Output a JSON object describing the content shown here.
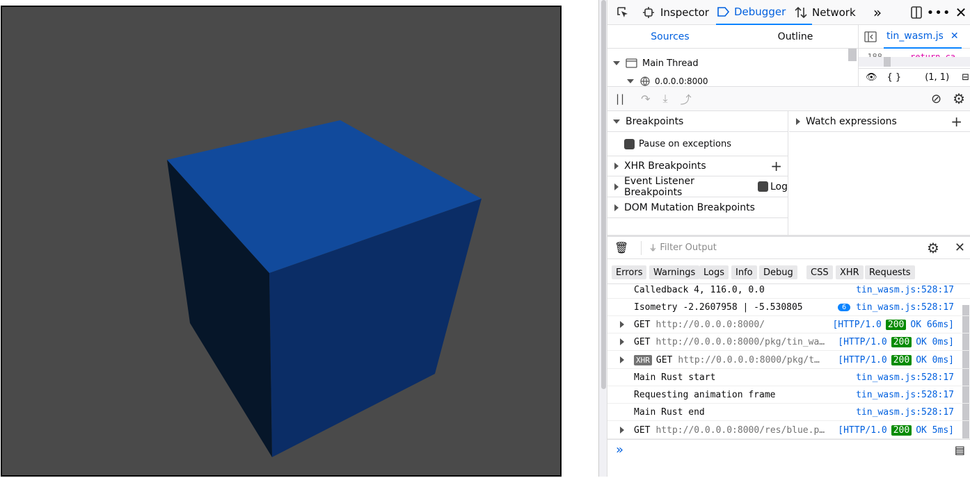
{
  "toolbar": {
    "tabs": [
      "Inspector",
      "Debugger",
      "Network"
    ]
  },
  "sources": {
    "tabs": [
      "Sources",
      "Outline"
    ],
    "main_thread": "Main Thread",
    "host": "0.0.0.0:8000"
  },
  "editor": {
    "file_tab": "tin_wasm.js",
    "line_no": "188",
    "code": "return ca",
    "cursor": "(1, 1)",
    "braces": "{ }"
  },
  "breakpoints": {
    "title": "Breakpoints",
    "pause_on_exceptions": "Pause on exceptions",
    "xhr": "XHR Breakpoints",
    "event_listener": "Event Listener Breakpoints",
    "log_label": "Log",
    "dom_mutation": "DOM Mutation Breakpoints"
  },
  "watch": {
    "title": "Watch expressions"
  },
  "console": {
    "filter_placeholder": "Filter Output",
    "filters": [
      "Errors",
      "Warnings",
      "Logs",
      "Info",
      "Debug",
      "CSS",
      "XHR",
      "Requests"
    ],
    "lines": [
      {
        "text": "Calledback 4, 116.0, 0.0",
        "source": "tin_wasm.js:528:17"
      },
      {
        "text": "Isometry -2.2607958 | -5.530805",
        "badge": "6",
        "source": "tin_wasm.js:528:17"
      },
      {
        "method": "GET",
        "url": "http://0.0.0.0:8000/",
        "http": "[HTTP/1.0",
        "status": "200",
        "result": "OK 66ms]"
      },
      {
        "method": "GET",
        "url": "http://0.0.0.0:8000/pkg/tin_wa…",
        "http": "[HTTP/1.0",
        "status": "200",
        "result": "OK 0ms]"
      },
      {
        "tag": "XHR",
        "method": "GET",
        "url": "http://0.0.0.0:8000/pkg/t…",
        "http": "[HTTP/1.0",
        "status": "200",
        "result": "OK 0ms]"
      },
      {
        "text": "Main Rust start",
        "source": "tin_wasm.js:528:17"
      },
      {
        "text": "Requesting animation frame",
        "source": "tin_wasm.js:528:17"
      },
      {
        "text": "Main Rust end",
        "source": "tin_wasm.js:528:17"
      },
      {
        "method": "GET",
        "url": "http://0.0.0.0:8000/res/blue.p…",
        "http": "[HTTP/1.0",
        "status": "200",
        "result": "OK 5ms]"
      }
    ],
    "prompt": "»"
  },
  "colors": {
    "canvas_bg": "#4a4a4a",
    "cube_top": "#114a9c",
    "cube_right": "#0b2d66",
    "cube_left": "#061629",
    "accent": "#0060df"
  }
}
